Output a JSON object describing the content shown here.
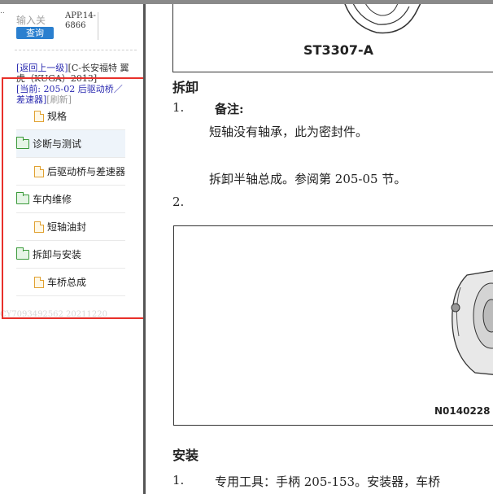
{
  "sidebar": {
    "search": {
      "placeholder": "输入关",
      "button_label": "查询"
    },
    "app_version": "APP.14-6866",
    "breadcrumb": {
      "back_link": "[返回上一级]",
      "path_text": "[C-长安福特 翼虎（KUGA）2013]",
      "current_prefix": "[当前: ",
      "current_code": "205-02",
      "current_name": " 后驱动桥／差速器",
      "current_suffix": "]",
      "refresh": "[刷新]"
    },
    "tree": [
      {
        "label": "规格",
        "type": "document"
      },
      {
        "label": "诊断与测试",
        "type": "folder"
      },
      {
        "label": "后驱动桥与差速器",
        "type": "document"
      },
      {
        "label": "车内维修",
        "type": "folder"
      },
      {
        "label": "短轴油封",
        "type": "document"
      },
      {
        "label": "拆卸与安装",
        "type": "folder"
      },
      {
        "label": "车桥总成",
        "type": "document"
      }
    ],
    "footer_code": "CY7093492562 20211220"
  },
  "document": {
    "figure1_label": "ST3307-A",
    "section_remove": "拆卸",
    "step1_num": "1.",
    "note_label": "备注:",
    "note_text": "短轴没有轴承，此为密封件。",
    "step1_text": "拆卸半轴总成。参阅第 205-05 节。",
    "step2_num": "2.",
    "figure2_label": "N0140228",
    "section_install": "安装",
    "install_step1_num": "1.",
    "install_step1_text": "专用工具：手柄 205-153。安装器，车桥"
  },
  "colors": {
    "highlight_box": "#e8302a",
    "query_button": "#2a7fcf",
    "link": "#2a2ab0",
    "folder_icon": "#3a9a3a",
    "document_icon": "#e0a030"
  }
}
